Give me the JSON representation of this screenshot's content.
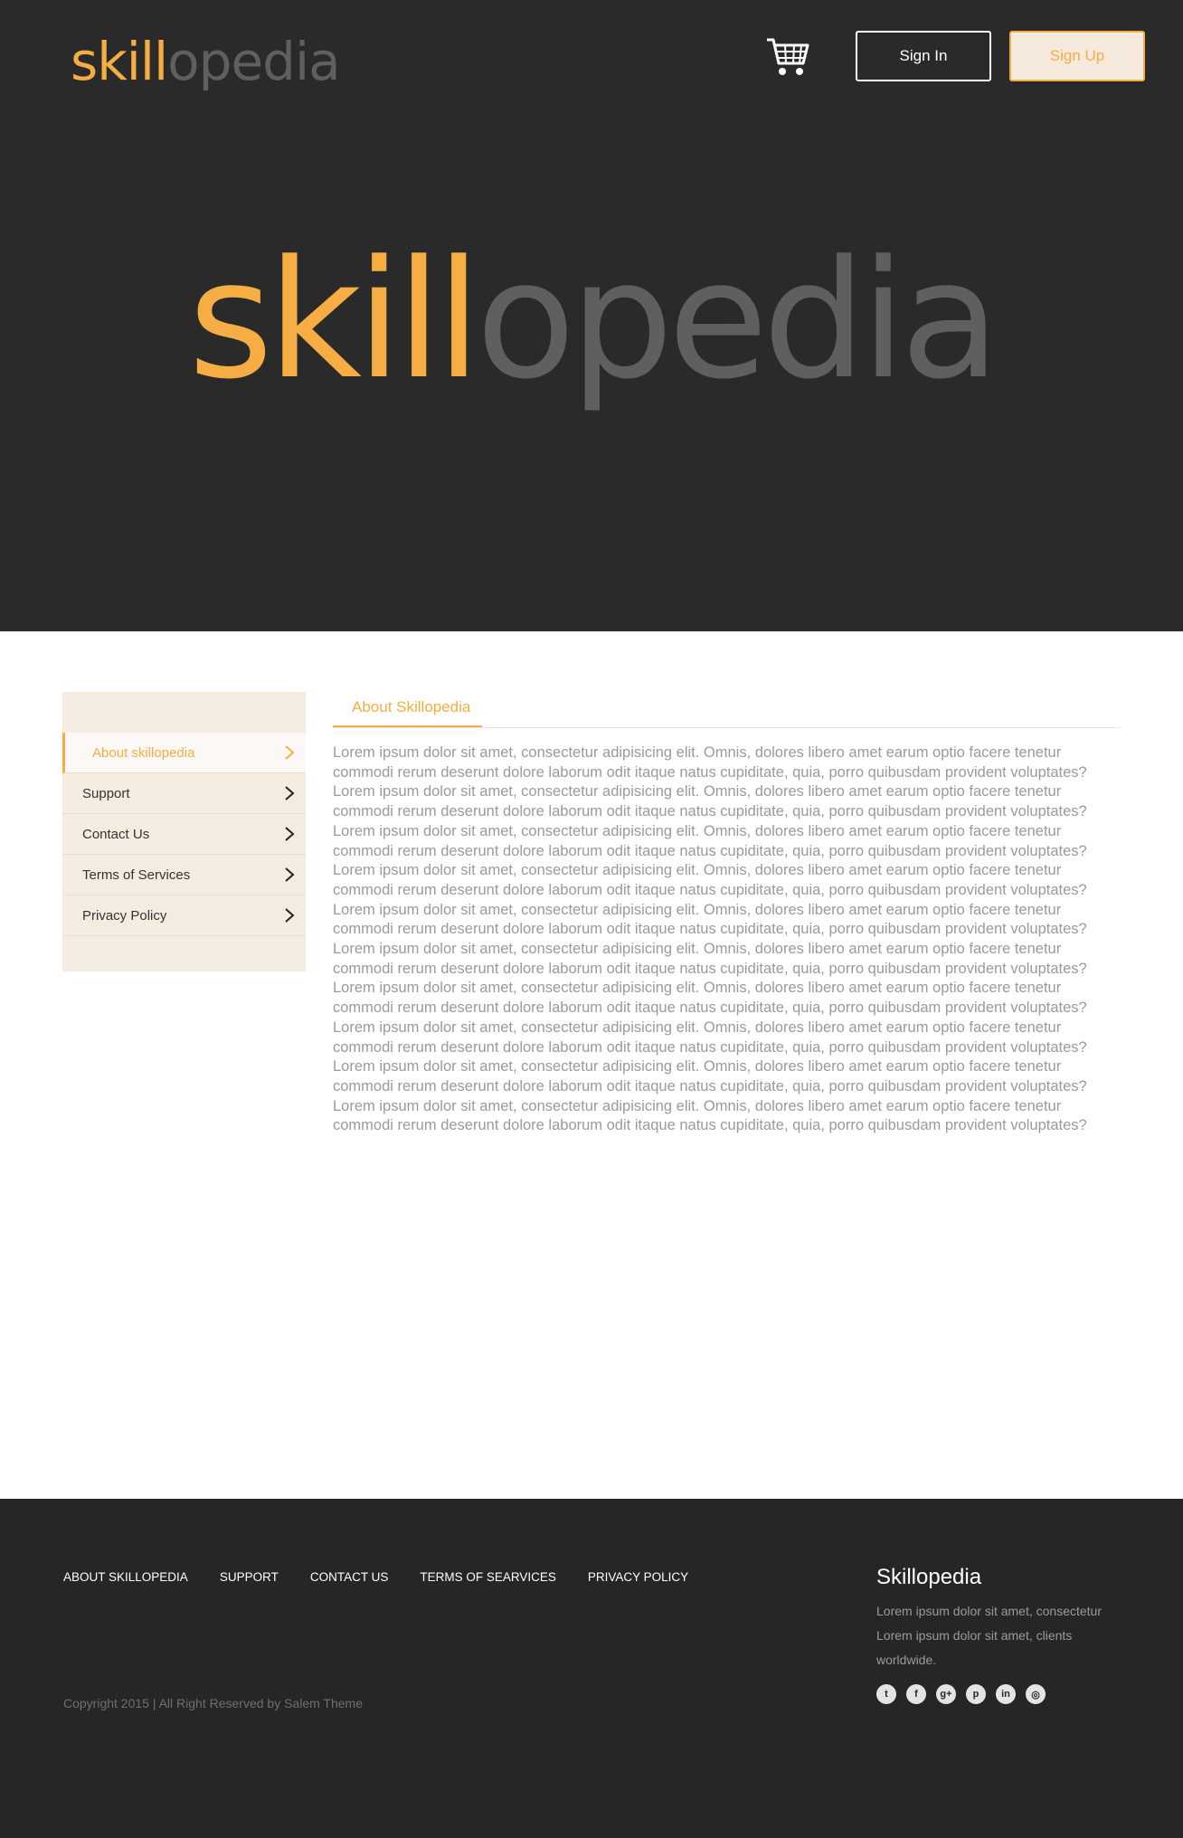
{
  "header": {
    "logo_part1": "skill",
    "logo_part2": "opedia",
    "cart_icon": "shopping-cart-icon",
    "signin_label": "Sign In",
    "signup_label": "Sign Up"
  },
  "hero": {
    "logo_part1": "skill",
    "logo_part2": "opedia"
  },
  "sidebar": {
    "items": [
      {
        "label": "About skillopedia",
        "active": true
      },
      {
        "label": "Support"
      },
      {
        "label": "Contact Us"
      },
      {
        "label": "Terms of Services"
      },
      {
        "label": "Privacy Policy"
      }
    ]
  },
  "main": {
    "tab_label": "About Skillopedia",
    "paragraphs": [
      "Lorem ipsum dolor sit amet, consectetur adipisicing elit. Omnis, dolores libero amet earum optio facere tenetur commodi rerum deserunt dolore laborum odit itaque natus cupiditate, quia, porro quibusdam provident voluptates?",
      "Lorem ipsum dolor sit amet, consectetur adipisicing elit. Omnis, dolores libero amet earum optio facere tenetur commodi rerum deserunt dolore laborum odit itaque natus cupiditate, quia, porro quibusdam provident voluptates?",
      "Lorem ipsum dolor sit amet, consectetur adipisicing elit. Omnis, dolores libero amet earum optio facere tenetur commodi rerum deserunt dolore laborum odit itaque natus cupiditate, quia, porro quibusdam provident voluptates?",
      "Lorem ipsum dolor sit amet, consectetur adipisicing elit. Omnis, dolores libero amet earum optio facere tenetur commodi rerum deserunt dolore laborum odit itaque natus cupiditate, quia, porro quibusdam provident voluptates?",
      "Lorem ipsum dolor sit amet, consectetur adipisicing elit. Omnis, dolores libero amet earum optio facere tenetur commodi rerum deserunt dolore laborum odit itaque natus cupiditate, quia, porro quibusdam provident voluptates?",
      "Lorem ipsum dolor sit amet, consectetur adipisicing elit. Omnis, dolores libero amet earum optio facere tenetur commodi rerum deserunt dolore laborum odit itaque natus cupiditate, quia, porro quibusdam provident voluptates?",
      "Lorem ipsum dolor sit amet, consectetur adipisicing elit. Omnis, dolores libero amet earum optio facere tenetur commodi rerum deserunt dolore laborum odit itaque natus cupiditate, quia, porro quibusdam provident voluptates?",
      "Lorem ipsum dolor sit amet, consectetur adipisicing elit. Omnis, dolores libero amet earum optio facere tenetur commodi rerum deserunt dolore laborum odit itaque natus cupiditate, quia, porro quibusdam provident voluptates?",
      "Lorem ipsum dolor sit amet, consectetur adipisicing elit. Omnis, dolores libero amet earum optio facere tenetur commodi rerum deserunt dolore laborum odit itaque natus cupiditate, quia, porro quibusdam provident voluptates?",
      "Lorem ipsum dolor sit amet, consectetur adipisicing elit. Omnis, dolores libero amet earum optio facere tenetur commodi rerum deserunt dolore laborum odit itaque natus cupiditate, quia, porro quibusdam provident voluptates?"
    ]
  },
  "footer": {
    "nav": [
      "ABOUT SKILLOPEDIA",
      "SUPPORT",
      "CONTACT US",
      "TERMS OF SEARVICES",
      "PRIVACY POLICY"
    ],
    "copyright": "Copyright 2015 | All Right Reserved by Salem Theme",
    "brand": "Skillopedia",
    "description": "Lorem ipsum dolor sit amet, consectetur Lorem ipsum dolor sit amet,  clients worldwide.",
    "socials": [
      {
        "icon": "twitter-icon",
        "glyph": "t"
      },
      {
        "icon": "facebook-icon",
        "glyph": "f"
      },
      {
        "icon": "google-plus-icon",
        "glyph": "g+"
      },
      {
        "icon": "pinterest-icon",
        "glyph": "p"
      },
      {
        "icon": "linkedin-icon",
        "glyph": "in"
      },
      {
        "icon": "dribbble-icon",
        "glyph": "◎"
      }
    ]
  },
  "colors": {
    "accent": "#f6ad43",
    "dark_bg": "#2a2a2b",
    "footer_bg": "#262626",
    "sidebar_bg": "#f4ebe1",
    "logo_grey": "#5f5f60"
  }
}
